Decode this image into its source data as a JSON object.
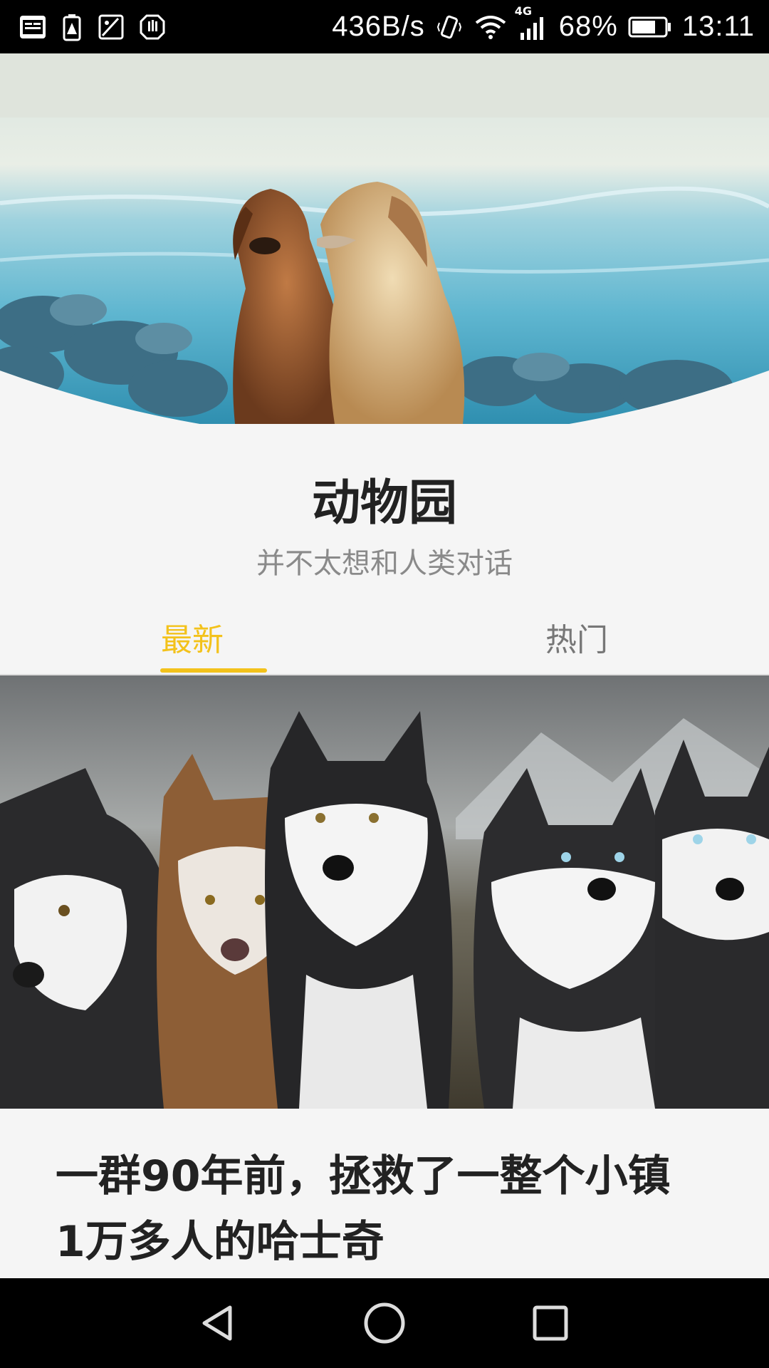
{
  "status_bar": {
    "net_speed": "436B/s",
    "network_type": "4G",
    "battery": "68%",
    "time": "13:11",
    "left_icons": [
      "toutiao-app-icon",
      "battery-warning-icon",
      "image-icon",
      "hand-icon"
    ],
    "right_icons": [
      "vibrate-icon",
      "wifi-icon",
      "signal-icon",
      "battery-icon"
    ]
  },
  "hero": {
    "image_desc": "two-golden-retrievers-on-beach"
  },
  "profile": {
    "title": "动物园",
    "subtitle": "并不太想和人类对话"
  },
  "tabs": [
    {
      "label": "最新",
      "active": true
    },
    {
      "label": "热门",
      "active": false
    }
  ],
  "colors": {
    "accent": "#f3c21b",
    "text": "#222222",
    "muted": "#8a8a8a"
  },
  "article": {
    "title": "一群90年前，拯救了一整个小镇1万多人的哈士奇"
  },
  "nav": {
    "icons": [
      "back-icon",
      "home-icon",
      "recents-icon"
    ]
  }
}
